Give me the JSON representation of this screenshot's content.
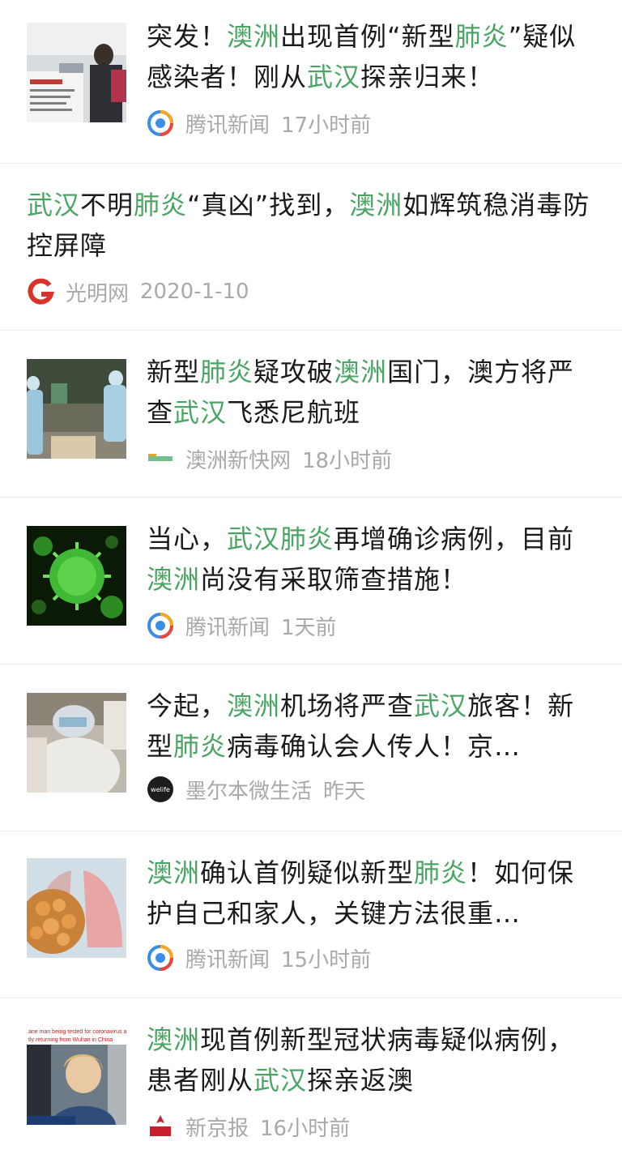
{
  "items": [
    {
      "title_segments": [
        {
          "text": "突发！",
          "hl": false
        },
        {
          "text": "澳洲",
          "hl": true
        },
        {
          "text": "出现首例“新型",
          "hl": false
        },
        {
          "text": "肺炎",
          "hl": true
        },
        {
          "text": "”疑似感染者！刚从",
          "hl": false
        },
        {
          "text": "武汉",
          "hl": true
        },
        {
          "text": "探亲归来！",
          "hl": false
        }
      ],
      "source": "腾讯新闻",
      "time": "17小时前",
      "logo": "tencent-news-logo"
    },
    {
      "title_segments": [
        {
          "text": "武汉",
          "hl": true
        },
        {
          "text": "不明",
          "hl": false
        },
        {
          "text": "肺炎",
          "hl": true
        },
        {
          "text": "“真凶”找到，",
          "hl": false
        },
        {
          "text": "澳洲",
          "hl": true
        },
        {
          "text": "如辉筑稳消毒防控屏障",
          "hl": false
        }
      ],
      "source": "光明网",
      "time": "2020-1-10",
      "logo": "guangming-logo"
    },
    {
      "title_segments": [
        {
          "text": "新型",
          "hl": false
        },
        {
          "text": "肺炎",
          "hl": true
        },
        {
          "text": "疑攻破",
          "hl": false
        },
        {
          "text": "澳洲",
          "hl": true
        },
        {
          "text": "国门，澳方将严查",
          "hl": false
        },
        {
          "text": "武汉",
          "hl": true
        },
        {
          "text": "飞悉尼航班",
          "hl": false
        }
      ],
      "source": "澳洲新快网",
      "time": "18小时前",
      "logo": "xinkuai-logo"
    },
    {
      "title_segments": [
        {
          "text": "当心，",
          "hl": false
        },
        {
          "text": "武汉",
          "hl": true
        },
        {
          "text": "肺炎",
          "hl": true
        },
        {
          "text": "再增确诊病例，目前",
          "hl": false
        },
        {
          "text": "澳洲",
          "hl": true
        },
        {
          "text": "尚没有采取筛查措施！",
          "hl": false
        }
      ],
      "source": "腾讯新闻",
      "time": "1天前",
      "logo": "tencent-news-logo"
    },
    {
      "title_segments": [
        {
          "text": "今起，",
          "hl": false
        },
        {
          "text": "澳洲",
          "hl": true
        },
        {
          "text": "机场将严查",
          "hl": false
        },
        {
          "text": "武汉",
          "hl": true
        },
        {
          "text": "旅客！新型",
          "hl": false
        },
        {
          "text": "肺炎",
          "hl": true
        },
        {
          "text": "病毒确认会人传人！京…",
          "hl": false
        }
      ],
      "source": "墨尔本微生活",
      "time": "昨天",
      "logo": "welife-logo",
      "logo_text": "welife"
    },
    {
      "title_segments": [
        {
          "text": "澳洲",
          "hl": true
        },
        {
          "text": "确认首例疑似新型",
          "hl": false
        },
        {
          "text": "肺炎",
          "hl": true
        },
        {
          "text": "！如何保护自己和家人，关键方法很重…",
          "hl": false
        }
      ],
      "source": "腾讯新闻",
      "time": "15小时前",
      "logo": "tencent-news-logo"
    },
    {
      "title_segments": [
        {
          "text": "澳洲",
          "hl": true
        },
        {
          "text": "现首例新型冠状病毒疑似病例，患者刚从",
          "hl": false
        },
        {
          "text": "武汉",
          "hl": true
        },
        {
          "text": "探亲返澳",
          "hl": false
        }
      ],
      "source": "新京报",
      "time": "16小时前",
      "logo": "xinjingbao-logo",
      "thumb_caption": "ane man being tested for coronavirus a tly returning from Wuhan in China"
    }
  ],
  "colors": {
    "highlight": "#4aa564",
    "title": "#1a1a1a",
    "meta": "#a9a9a9",
    "divider": "#ececec"
  }
}
